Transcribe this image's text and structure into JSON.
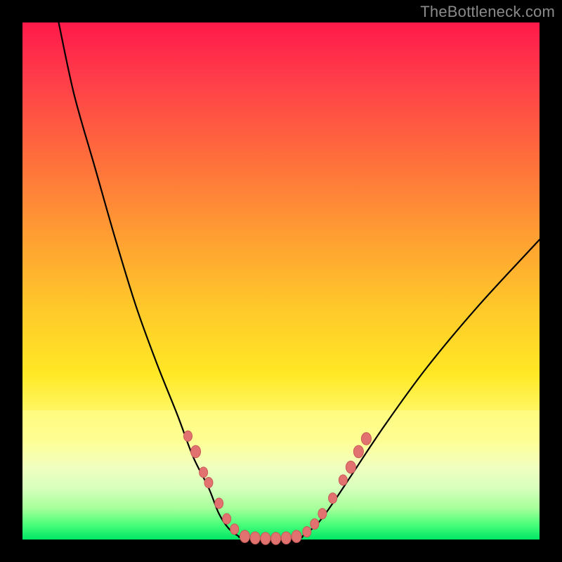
{
  "watermark": "TheBottleneck.com",
  "chart_data": {
    "type": "line",
    "title": "",
    "xlabel": "",
    "ylabel": "",
    "xlim": [
      0,
      100
    ],
    "ylim": [
      0,
      100
    ],
    "grid": false,
    "legend": false,
    "background_gradient": {
      "top": "#ff1a4a",
      "mid": "#ffe825",
      "bottom": "#00e765"
    },
    "series": [
      {
        "name": "bottleneck-curve-left",
        "x": [
          7,
          10,
          14,
          18,
          22,
          26,
          30,
          33,
          36,
          38,
          40,
          42
        ],
        "y": [
          100,
          86,
          72,
          58,
          45,
          34,
          24,
          16,
          10,
          5,
          2,
          0.5
        ]
      },
      {
        "name": "bottleneck-curve-bottom",
        "x": [
          42,
          45,
          48,
          51,
          54
        ],
        "y": [
          0.5,
          0,
          0,
          0,
          0.5
        ]
      },
      {
        "name": "bottleneck-curve-right",
        "x": [
          54,
          57,
          60,
          64,
          70,
          78,
          88,
          100
        ],
        "y": [
          0.5,
          3,
          7,
          13,
          22,
          33,
          45,
          58
        ]
      }
    ],
    "markers": {
      "name": "highlighted-points",
      "color": "#e2726f",
      "points": [
        {
          "x": 32.0,
          "y": 20.0,
          "r": 6
        },
        {
          "x": 33.5,
          "y": 17.0,
          "r": 7
        },
        {
          "x": 35.0,
          "y": 13.0,
          "r": 6
        },
        {
          "x": 36.0,
          "y": 11.0,
          "r": 6
        },
        {
          "x": 38.0,
          "y": 7.0,
          "r": 6
        },
        {
          "x": 39.5,
          "y": 4.0,
          "r": 6
        },
        {
          "x": 41.0,
          "y": 2.0,
          "r": 6
        },
        {
          "x": 43.0,
          "y": 0.6,
          "r": 7
        },
        {
          "x": 45.0,
          "y": 0.3,
          "r": 7
        },
        {
          "x": 47.0,
          "y": 0.2,
          "r": 7
        },
        {
          "x": 49.0,
          "y": 0.2,
          "r": 7
        },
        {
          "x": 51.0,
          "y": 0.3,
          "r": 7
        },
        {
          "x": 53.0,
          "y": 0.6,
          "r": 7
        },
        {
          "x": 55.0,
          "y": 1.5,
          "r": 6
        },
        {
          "x": 56.5,
          "y": 3.0,
          "r": 6
        },
        {
          "x": 58.0,
          "y": 5.0,
          "r": 6
        },
        {
          "x": 60.0,
          "y": 8.0,
          "r": 6
        },
        {
          "x": 62.0,
          "y": 11.5,
          "r": 6
        },
        {
          "x": 63.5,
          "y": 14.0,
          "r": 7
        },
        {
          "x": 65.0,
          "y": 17.0,
          "r": 7
        },
        {
          "x": 66.5,
          "y": 19.5,
          "r": 7
        }
      ]
    }
  }
}
